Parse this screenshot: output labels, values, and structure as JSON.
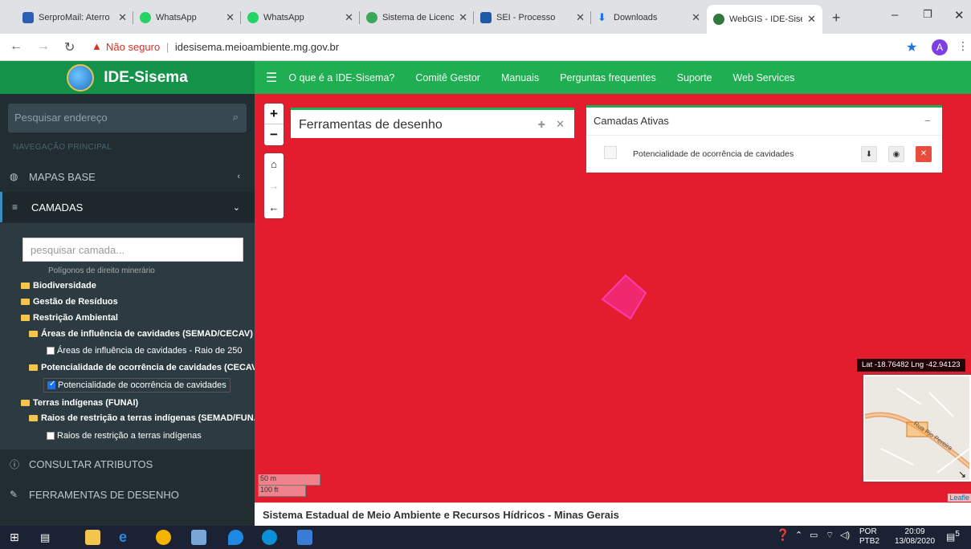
{
  "browser": {
    "tabs": [
      {
        "title": "SerproMail: Aterro",
        "icon": "serpro-icon",
        "color": "#2b5fb4"
      },
      {
        "title": "WhatsApp",
        "icon": "whatsapp-icon",
        "color": "#25d366"
      },
      {
        "title": "WhatsApp",
        "icon": "whatsapp-icon",
        "color": "#25d366"
      },
      {
        "title": "Sistema de Licenci",
        "icon": "licenciamento-icon",
        "color": "#3aa856"
      },
      {
        "title": "SEI - Processo",
        "icon": "sei-icon",
        "color": "#1d5aa8"
      },
      {
        "title": "Downloads",
        "icon": "download-icon",
        "color": "#1a73e8"
      },
      {
        "title": "WebGIS - IDE-Sise",
        "icon": "globe-icon",
        "color": "#2f7a3a"
      }
    ],
    "active_tab": 6,
    "new_tab": "+",
    "address": {
      "not_secure": "Não seguro",
      "separator": "|",
      "url": "idesisema.meioambiente.mg.gov.br"
    },
    "avatar": "A"
  },
  "app": {
    "brand": "IDE-Sisema",
    "nav": [
      "O que é a IDE-Sisema?",
      "Comitê Gestor",
      "Manuais",
      "Perguntas frequentes",
      "Suporte",
      "Web Services"
    ]
  },
  "sidebar": {
    "search_placeholder": "Pesquisar endereço",
    "section_heading": "NAVEGAÇÃO PRINCIPAL",
    "items": {
      "base": "MAPAS BASE",
      "layers": "CAMADAS",
      "attributes": "CONSULTAR ATRIBUTOS",
      "drawing": "FERRAMENTAS DE DESENHO"
    },
    "layer_search_placeholder": "pesquisar camada...",
    "tree": {
      "partial": "Polígonos de direito minerário",
      "biodiversidade": "Biodiversidade",
      "residuos": "Gestão de Resíduos",
      "restricao": "Restrição Ambiental",
      "areas_group": "Áreas de influência de cavidades (SEMAD/CECAV)",
      "areas_layer": "Áreas de influência de cavidades - Raio de 250",
      "potencial_group": "Potencialidade de ocorrência de cavidades (CECAV",
      "potencial_layer": "Potencialidade de ocorrência de cavidades",
      "terras": "Terras indígenas (FUNAI)",
      "raios_group": "Raios de restrição a terras indígenas (SEMAD/FUNA",
      "raios_layer": "Raios de restrição a terras indígenas"
    }
  },
  "map": {
    "draw_panel_title": "Ferramentas de desenho",
    "active_layers_title": "Camadas Ativas",
    "active_layer_name": "Potencialidade de ocorrência de cavidades",
    "coords": "Lat -18.76482 Lng -42.94123",
    "scale_m": "50 m",
    "scale_ft": "100 ft",
    "attribution": "Leafle",
    "minimap_street": "Rua Pio Pereira",
    "background_color": "#e31d2d",
    "polygon_color": "#ff2a8a"
  },
  "footer": "Sistema Estadual de Meio Ambiente e Recursos Hídricos - Minas Gerais",
  "taskbar": {
    "lang1": "POR",
    "lang2": "PTB2",
    "time": "20:09",
    "date": "13/08/2020",
    "notifications": "5"
  }
}
